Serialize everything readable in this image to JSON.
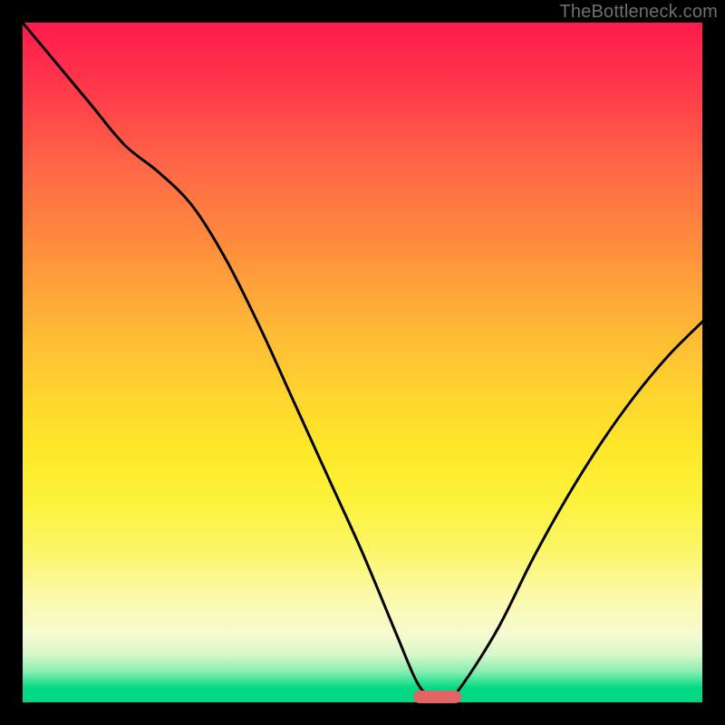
{
  "watermark": "TheBottleneck.com",
  "colors": {
    "frame": "#000000",
    "curve": "#000000",
    "marker": "#e06666",
    "gradient_top": "#ff1a4d",
    "gradient_bottom": "#00d884"
  },
  "chart_data": {
    "type": "line",
    "title": "",
    "xlabel": "",
    "ylabel": "",
    "xlim": [
      0,
      100
    ],
    "ylim": [
      0,
      100
    ],
    "x": [
      0,
      5,
      10,
      15,
      20,
      25,
      30,
      35,
      40,
      45,
      50,
      55,
      58,
      60,
      63,
      65,
      70,
      75,
      80,
      85,
      90,
      95,
      100
    ],
    "values": [
      100,
      94,
      88,
      82,
      78,
      73,
      65,
      55,
      44,
      33,
      22,
      10,
      3,
      1,
      1,
      3,
      11,
      21,
      30,
      38,
      45,
      51,
      56
    ],
    "optimum_x": 61,
    "optimum_width": 7
  }
}
